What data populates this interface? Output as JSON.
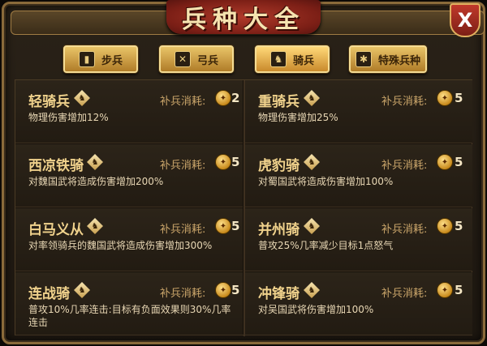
{
  "dialog": {
    "title": "兵种大全",
    "close_label": "X"
  },
  "tabs": [
    {
      "label": "步兵",
      "icon": "infantry-icon",
      "icon_glyph": "▮"
    },
    {
      "label": "弓兵",
      "icon": "archer-icon",
      "icon_glyph": "✕"
    },
    {
      "label": "骑兵",
      "icon": "cavalry-icon",
      "icon_glyph": "♞"
    },
    {
      "label": "特殊兵种",
      "icon": "special-icon",
      "icon_glyph": "✱"
    }
  ],
  "units": [
    {
      "name": "轻骑兵",
      "cost_label": "补兵消耗:",
      "cost": "2",
      "desc": "物理伤害增加12%"
    },
    {
      "name": "重骑兵",
      "cost_label": "补兵消耗:",
      "cost": "5",
      "desc": "物理伤害增加25%"
    },
    {
      "name": "西凉铁骑",
      "cost_label": "补兵消耗:",
      "cost": "5",
      "desc": "对魏国武将造成伤害增加200%"
    },
    {
      "name": "虎豹骑",
      "cost_label": "补兵消耗:",
      "cost": "5",
      "desc": "对蜀国武将造成伤害增加100%"
    },
    {
      "name": "白马义从",
      "cost_label": "补兵消耗:",
      "cost": "5",
      "desc": "对率领骑兵的魏国武将造成伤害增加300%"
    },
    {
      "name": "并州骑",
      "cost_label": "补兵消耗:",
      "cost": "5",
      "desc": "普攻25%几率减少目标1点怒气"
    },
    {
      "name": "连战骑",
      "cost_label": "补兵消耗:",
      "cost": "5",
      "desc": "普攻10%几率连击:目标有负面效果则30%几率连击"
    },
    {
      "name": "冲锋骑",
      "cost_label": "补兵消耗:",
      "cost": "5",
      "desc": "对吴国武将伤害增加100%"
    }
  ],
  "colors": {
    "accent_gold": "#e9c468",
    "title_red": "#b03a2a",
    "name_text": "#f0d28c"
  }
}
